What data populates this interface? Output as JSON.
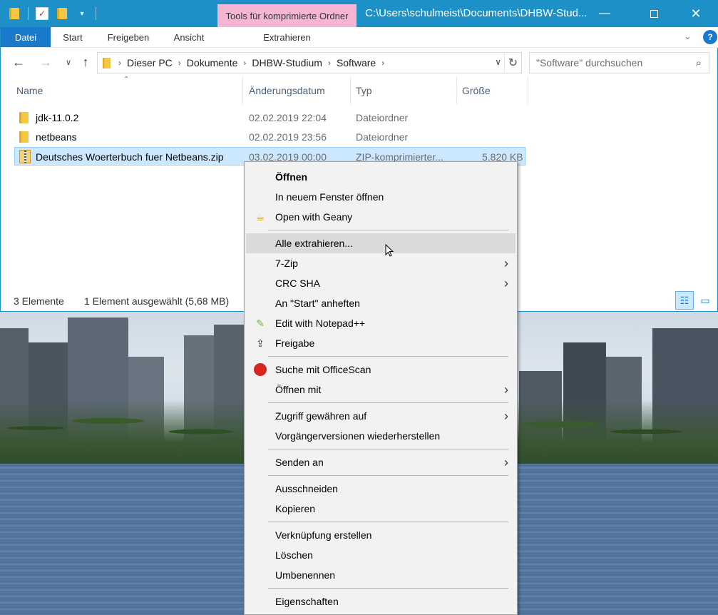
{
  "window": {
    "title": "C:\\Users\\schulmeist\\Documents\\DHBW-Stud...",
    "context_tab": "Tools für komprimierte Ordner",
    "accent": "#1e90c8"
  },
  "ribbon": {
    "tabs": [
      "Datei",
      "Start",
      "Freigeben",
      "Ansicht"
    ],
    "context_tab": "Extrahieren"
  },
  "nav": {
    "breadcrumb": [
      "Dieser PC",
      "Dokumente",
      "DHBW-Studium",
      "Software"
    ],
    "search_placeholder": "\"Software\" durchsuchen"
  },
  "columns": [
    "Name",
    "Änderungsdatum",
    "Typ",
    "Größe"
  ],
  "files": [
    {
      "name": "jdk-11.0.2",
      "date": "02.02.2019 22:04",
      "type": "Dateiordner",
      "size": "",
      "icon": "folder-icon"
    },
    {
      "name": "netbeans",
      "date": "02.02.2019 23:56",
      "type": "Dateiordner",
      "size": "",
      "icon": "folder-icon"
    },
    {
      "name": "Deutsches Woerterbuch fuer Netbeans.zip",
      "date": "03.02.2019 00:00",
      "type": "ZIP-komprimierter...",
      "size": "5.820 KB",
      "icon": "zip-icon"
    }
  ],
  "status": {
    "count": "3 Elemente",
    "selection": "1 Element ausgewählt (5,68 MB)"
  },
  "context_menu": {
    "items": [
      {
        "label": "Öffnen"
      },
      {
        "label": "In neuem Fenster öffnen"
      },
      {
        "label": "Open with Geany"
      },
      {
        "label": "Alle extrahieren..."
      },
      {
        "label": "7-Zip"
      },
      {
        "label": "CRC SHA"
      },
      {
        "label": "An \"Start\" anheften"
      },
      {
        "label": "Edit with Notepad++"
      },
      {
        "label": "Freigabe"
      },
      {
        "label": "Suche mit OfficeScan"
      },
      {
        "label": "Öffnen mit"
      },
      {
        "label": "Zugriff gewähren auf"
      },
      {
        "label": "Vorgängerversionen wiederherstellen"
      },
      {
        "label": "Senden an"
      },
      {
        "label": "Ausschneiden"
      },
      {
        "label": "Kopieren"
      },
      {
        "label": "Verknüpfung erstellen"
      },
      {
        "label": "Löschen"
      },
      {
        "label": "Umbenennen"
      },
      {
        "label": "Eigenschaften"
      }
    ]
  }
}
